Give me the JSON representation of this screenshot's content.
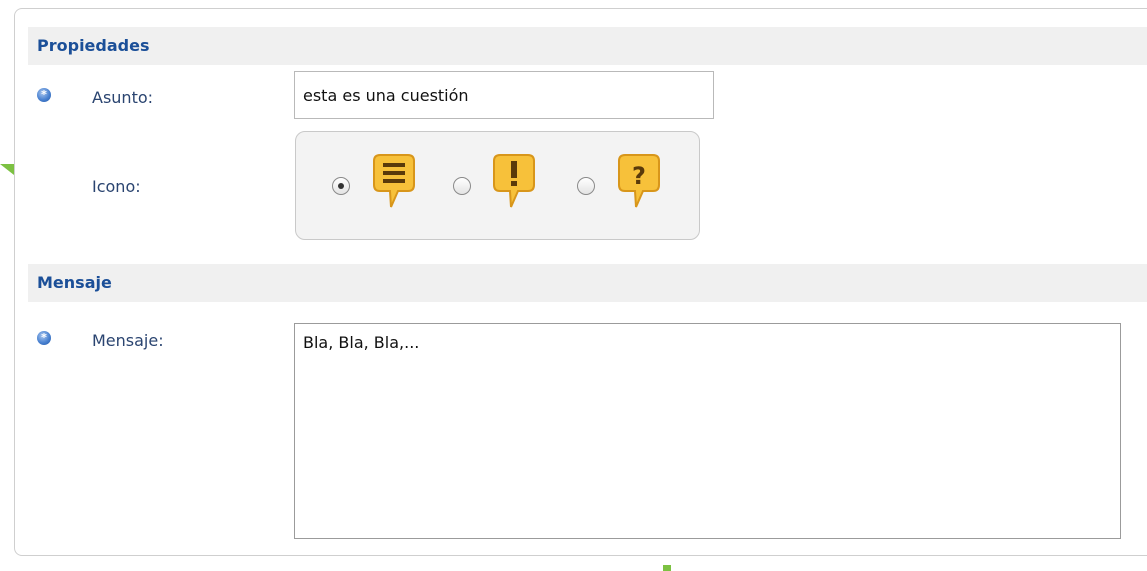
{
  "sections": {
    "properties": {
      "title": "Propiedades",
      "subject": {
        "label": "Asunto:",
        "value": "esta es una cuestión",
        "required": true
      },
      "icon": {
        "label": "Icono:",
        "options": [
          {
            "name": "message-bubble-icon",
            "glyph": "≡",
            "selected": true
          },
          {
            "name": "exclamation-bubble-icon",
            "glyph": "!",
            "selected": false
          },
          {
            "name": "question-bubble-icon",
            "glyph": "?",
            "selected": false
          }
        ]
      }
    },
    "message": {
      "title": "Mensaje",
      "body": {
        "label": "Mensaje:",
        "value": "Bla, Bla, Bla,...",
        "required": true
      }
    }
  },
  "colors": {
    "header_text": "#1b4f98",
    "label_text": "#2a4470",
    "bubble_fill": "#f7c13a",
    "bubble_stroke": "#d8961a",
    "bubble_glyph": "#5a3a0a",
    "accent_green": "#7cc142"
  }
}
